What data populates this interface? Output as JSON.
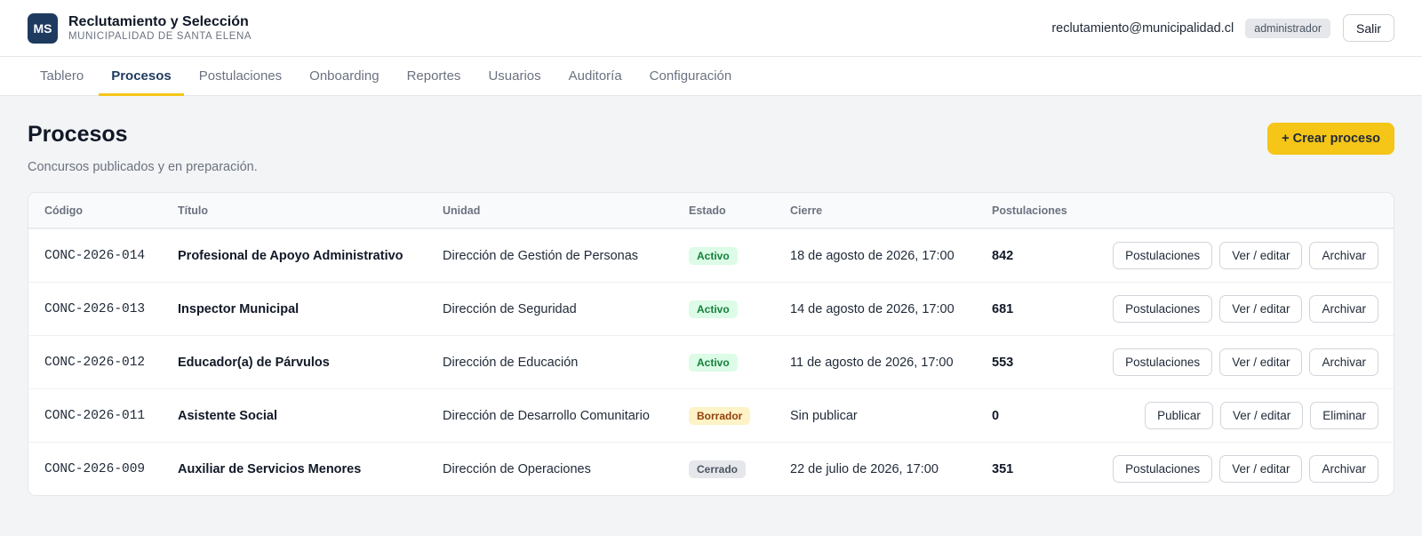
{
  "header": {
    "logo_text": "MS",
    "app_title": "Reclutamiento y Selección",
    "organization": "MUNICIPALIDAD DE SANTA ELENA",
    "user_email": "reclutamiento@municipalidad.cl",
    "role": "administrador",
    "logout_label": "Salir"
  },
  "nav": {
    "active": "Procesos",
    "tabs": [
      "Tablero",
      "Procesos",
      "Postulaciones",
      "Onboarding",
      "Reportes",
      "Usuarios",
      "Auditoría",
      "Configuración"
    ]
  },
  "page": {
    "title": "Procesos",
    "subtitle": "Concursos publicados y en preparación.",
    "create_label": "+ Crear proceso"
  },
  "table": {
    "columns": [
      "Código",
      "Título",
      "Unidad",
      "Estado",
      "Cierre",
      "Postulaciones"
    ],
    "rows": [
      {
        "code": "CONC-2026-014",
        "title": "Profesional de Apoyo Administrativo",
        "unit": "Dirección de Gestión de Personas",
        "status": "Activo",
        "close": "18 de agosto de 2026, 17:00",
        "applications": "842",
        "actions": [
          "Postulaciones",
          "Ver / editar",
          "Archivar"
        ]
      },
      {
        "code": "CONC-2026-013",
        "title": "Inspector Municipal",
        "unit": "Dirección de Seguridad",
        "status": "Activo",
        "close": "14 de agosto de 2026, 17:00",
        "applications": "681",
        "actions": [
          "Postulaciones",
          "Ver / editar",
          "Archivar"
        ]
      },
      {
        "code": "CONC-2026-012",
        "title": "Educador(a) de Párvulos",
        "unit": "Dirección de Educación",
        "status": "Activo",
        "close": "11 de agosto de 2026, 17:00",
        "applications": "553",
        "actions": [
          "Postulaciones",
          "Ver / editar",
          "Archivar"
        ]
      },
      {
        "code": "CONC-2026-011",
        "title": "Asistente Social",
        "unit": "Dirección de Desarrollo Comunitario",
        "status": "Borrador",
        "close": "Sin publicar",
        "applications": "0",
        "actions": [
          "Publicar",
          "Ver / editar",
          "Eliminar"
        ]
      },
      {
        "code": "CONC-2026-009",
        "title": "Auxiliar de Servicios Menores",
        "unit": "Dirección de Operaciones",
        "status": "Cerrado",
        "close": "22 de julio de 2026, 17:00",
        "applications": "351",
        "actions": [
          "Postulaciones",
          "Ver / editar",
          "Archivar"
        ]
      }
    ]
  },
  "colors": {
    "brand": "#1e3a5f",
    "accent": "#f5c518",
    "status_activo": "#15803d",
    "status_borrador": "#92400e",
    "status_cerrado": "#4b5563"
  }
}
